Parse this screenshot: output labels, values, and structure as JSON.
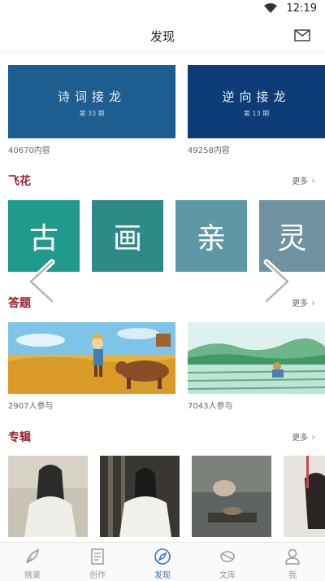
{
  "status": {
    "time": "12:19"
  },
  "header": {
    "title": "发现"
  },
  "banners": [
    {
      "title": "诗词接龙",
      "subtitle": "第 33 期",
      "count": "40670内容",
      "color": "#1e5d8f"
    },
    {
      "title": "逆向接龙",
      "subtitle": "第 13 期",
      "count": "49258内容",
      "color": "#0d3c78"
    }
  ],
  "feihua": {
    "title": "飞花",
    "more": "更多",
    "tiles": [
      {
        "char": "古",
        "color": "#1f9a8c"
      },
      {
        "char": "画",
        "color": "#2e8a86"
      },
      {
        "char": "亲",
        "color": "#5e97a6"
      },
      {
        "char": "灵",
        "color": "#6f93a0"
      }
    ]
  },
  "quiz": {
    "title": "答题",
    "more": "更多",
    "items": [
      {
        "participants": "2907人参与"
      },
      {
        "participants": "7043人参与"
      }
    ]
  },
  "albums": {
    "title": "专辑",
    "more": "更多"
  },
  "tabs": [
    {
      "label": "摘录",
      "icon": "quill-icon"
    },
    {
      "label": "创作",
      "icon": "notebook-icon"
    },
    {
      "label": "发现",
      "icon": "compass-icon",
      "active": true
    },
    {
      "label": "文库",
      "icon": "scroll-icon"
    },
    {
      "label": "我",
      "icon": "person-icon"
    }
  ]
}
